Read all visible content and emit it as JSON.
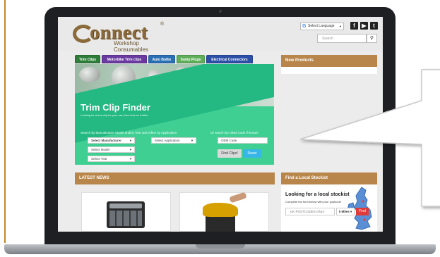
{
  "site": {
    "logo_text": "onnect",
    "logo_registered": "®",
    "logo_subtitle": "Workshop Consumables",
    "language_label": "Select Language",
    "language_caret": "▼",
    "search_placeholder": "Search",
    "search_icon": "magnifier-icon",
    "social": [
      "facebook-icon",
      "youtube-icon",
      "twitter-icon"
    ]
  },
  "tabs": [
    {
      "label": "Trim Clips",
      "color": "#2f7d3a"
    },
    {
      "label": "Motorbike Trim clips",
      "color": "#6a3aa0"
    },
    {
      "label": "Auto Bulbs",
      "color": "#2a6fb3"
    },
    {
      "label": "Sump Plugs",
      "color": "#5fae5a"
    },
    {
      "label": "Electrical Connectors",
      "color": "#2c4fa8"
    }
  ],
  "finder": {
    "title": "Trim Clip Finder",
    "subtitle": "Looking for a trim clip for your car, then look no further",
    "hint_left": "Search by Manufacturer Model and/or Year and refine by Application",
    "hint_right": "Or search by OEM Code if known:",
    "manufacturer": "Select Manufacturer",
    "model": "Select Model",
    "year": "Select Year",
    "application": "Select Application",
    "oem_placeholder": "OEM Code",
    "find_button": "Find Clips!",
    "reset_button": "Reset",
    "accent": "#3fcf93"
  },
  "new_products": {
    "title": "New Products"
  },
  "news": {
    "title": "LATEST NEWS"
  },
  "stockist": {
    "head": "Find a Local Stockist",
    "title": "Looking for a local stockist",
    "subtitle": "Complete the form below with your postcode",
    "postcode_placeholder": "UK POSTCODES ONLY",
    "miles": "5 Miles",
    "find": "Find"
  },
  "colors": {
    "brand_brown": "#b8864a",
    "find_red": "#e03a3a"
  }
}
